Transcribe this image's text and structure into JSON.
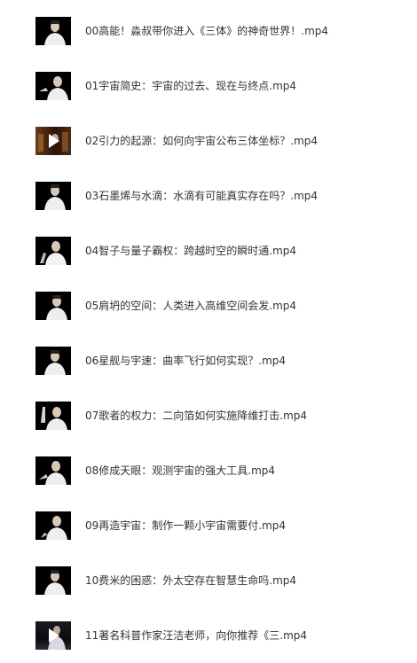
{
  "videos": [
    {
      "title": "00高能！淼叔带你进入《三体》的神奇世界！.mp4",
      "thumb_icon": "video-thumbnail-presenter",
      "has_play_icon": false
    },
    {
      "title": "01宇宙简史：宇宙的过去、现在与终点.mp4",
      "thumb_icon": "video-thumbnail-presenter",
      "has_play_icon": false
    },
    {
      "title": "02引力的起源：如何向宇宙公布三体坐标？.mp4",
      "thumb_icon": "video-thumbnail-presenter",
      "has_play_icon": true
    },
    {
      "title": "03石墨烯与水滴：水滴有可能真实存在吗？.mp4",
      "thumb_icon": "video-thumbnail-presenter",
      "has_play_icon": false
    },
    {
      "title": "04智子与量子霸权：跨越时空的瞬时通.mp4",
      "thumb_icon": "video-thumbnail-presenter",
      "has_play_icon": false
    },
    {
      "title": "05肩坍的空间：人类进入高维空间会发.mp4",
      "thumb_icon": "video-thumbnail-presenter",
      "has_play_icon": false
    },
    {
      "title": "06星舰与宇速：曲率飞行如何实现？.mp4",
      "thumb_icon": "video-thumbnail-presenter",
      "has_play_icon": false
    },
    {
      "title": "07歌者的权力：二向箔如何实施降维打击.mp4",
      "thumb_icon": "video-thumbnail-presenter",
      "has_play_icon": false
    },
    {
      "title": "08修成天眼：观测宇宙的强大工具.mp4",
      "thumb_icon": "video-thumbnail-presenter",
      "has_play_icon": false
    },
    {
      "title": "09再造宇宙：制作一颗小宇宙需要付.mp4",
      "thumb_icon": "video-thumbnail-presenter",
      "has_play_icon": false
    },
    {
      "title": "10费米的困惑：外太空存在智慧生命吗.mp4",
      "thumb_icon": "video-thumbnail-presenter",
      "has_play_icon": false
    },
    {
      "title": "11著名科普作家汪洁老师，向你推荐《三.mp4",
      "thumb_icon": "video-thumbnail-presenter",
      "has_play_icon": true
    }
  ],
  "colors": {
    "text": "#333333",
    "background": "#ffffff",
    "thumb_background": "#000000"
  }
}
